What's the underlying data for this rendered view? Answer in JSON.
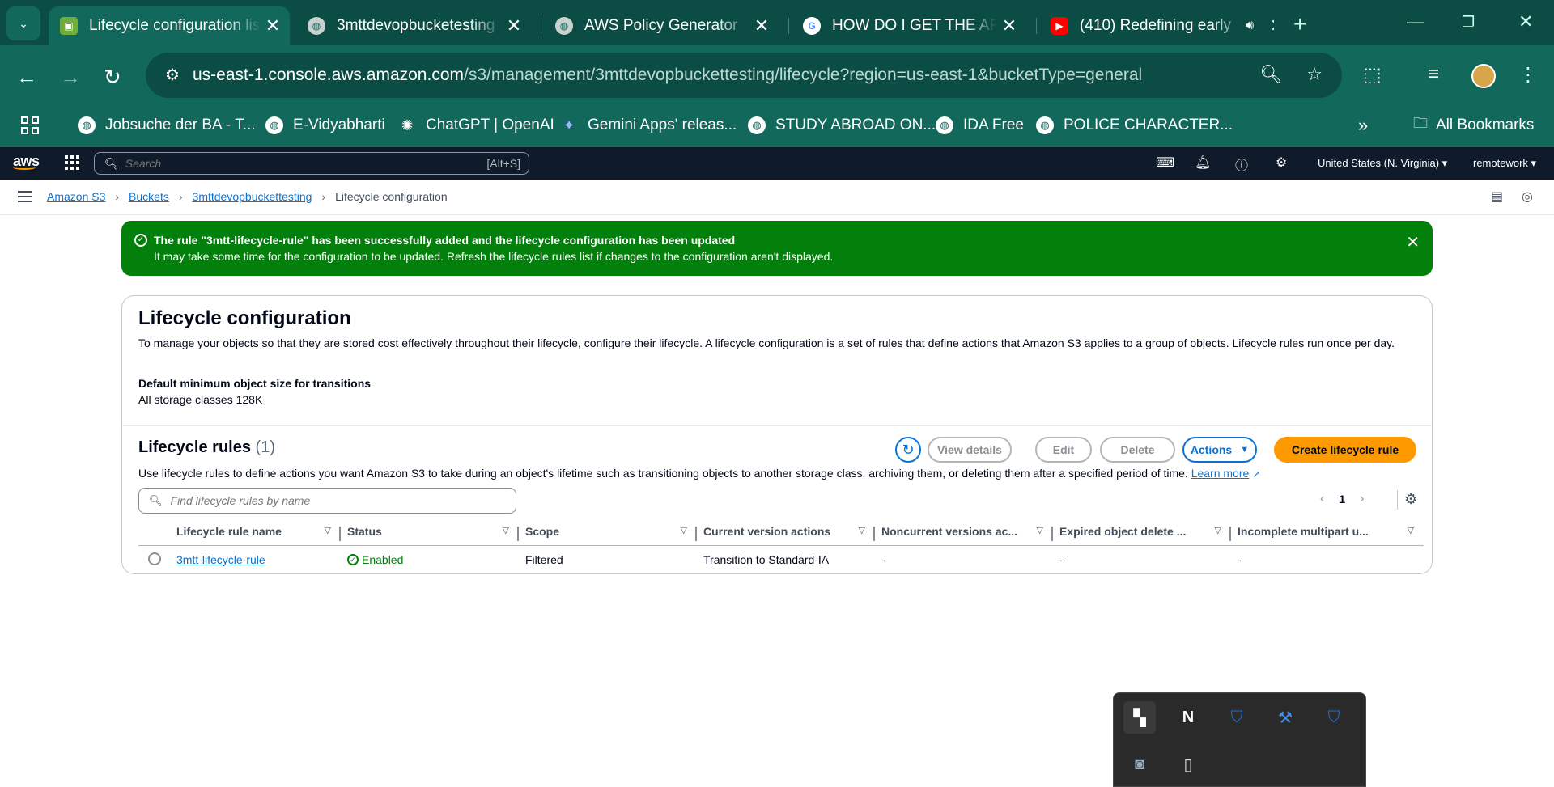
{
  "browser": {
    "tabs": [
      {
        "title": "Lifecycle configuration lis",
        "active": true,
        "favicon": "s3-icon"
      },
      {
        "title": "3mttdevopbucketesting",
        "active": false,
        "favicon": "globe-icon"
      },
      {
        "title": "AWS Policy Generator",
        "active": false,
        "favicon": "globe-icon"
      },
      {
        "title": "HOW DO I GET THE ARN",
        "active": false,
        "favicon": "google-icon"
      },
      {
        "title": "(410) Redefining early",
        "active": false,
        "favicon": "youtube-icon"
      }
    ],
    "url_host": "us-east-1.console.aws.amazon.com",
    "url_path": "/s3/management/3mttdevopbuckettesting/lifecycle?region=us-east-1&bucketType=general",
    "bookmarks": [
      "Jobsuche der BA - T...",
      "E-Vidyabharti",
      "ChatGPT | OpenAI",
      "Gemini Apps' releas...",
      "STUDY ABROAD ON...",
      "IDA Free",
      "POLICE CHARACTER..."
    ],
    "all_bookmarks": "All Bookmarks"
  },
  "aws": {
    "logo": "aws",
    "search_placeholder": "Search",
    "search_hint": "[Alt+S]",
    "region": "United States (N. Virginia) ▾",
    "account": "remotework ▾"
  },
  "breadcrumb": {
    "items": [
      "Amazon S3",
      "Buckets",
      "3mttdevopbuckettesting"
    ],
    "current": "Lifecycle configuration"
  },
  "flash": {
    "title": "The rule \"3mtt-lifecycle-rule\" has been successfully added and the lifecycle configuration has been updated",
    "body": "It may take some time for the configuration to be updated. Refresh the lifecycle rules list if changes to the configuration aren't displayed.",
    "color": "#037f0c"
  },
  "page": {
    "title": "Lifecycle configuration",
    "description": "To manage your objects so that they are stored cost effectively throughout their lifecycle, configure their lifecycle. A lifecycle configuration is a set of rules that define actions that Amazon S3 applies to a group of objects. Lifecycle rules run once per day.",
    "min_size_label": "Default minimum object size for transitions",
    "min_size_value": "All storage classes 128K"
  },
  "rules": {
    "title": "Lifecycle rules",
    "count": "(1)",
    "buttons": {
      "view_details": "View details",
      "edit": "Edit",
      "delete": "Delete",
      "actions": "Actions",
      "create": "Create lifecycle rule"
    },
    "description": "Use lifecycle rules to define actions you want Amazon S3 to take during an object's lifetime such as transitioning objects to another storage class, archiving them, or deleting them after a specified period of time.",
    "learn_more": "Learn more",
    "filter_placeholder": "Find lifecycle rules by name",
    "page": "1",
    "columns": [
      "Lifecycle rule name",
      "Status",
      "Scope",
      "Current version actions",
      "Noncurrent versions ac...",
      "Expired object delete ...",
      "Incomplete multipart u..."
    ],
    "rows": [
      {
        "name": "3mtt-lifecycle-rule",
        "status": "Enabled",
        "scope": "Filtered",
        "current": "Transition to Standard-IA",
        "noncurrent": "-",
        "expired": "-",
        "incomplete": "-"
      }
    ]
  },
  "accent_colors": {
    "primary": "#0972d3",
    "cta": "#ff9900",
    "chrome": "#13685c"
  }
}
